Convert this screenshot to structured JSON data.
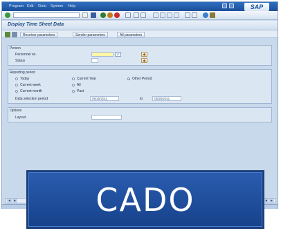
{
  "menubar": {
    "items": [
      "Program",
      "Edit",
      "Goto",
      "System",
      "Help"
    ],
    "logo": "SAP"
  },
  "toolbar": {
    "command_value": ""
  },
  "title": "Display Time Sheet Data",
  "app_toolbar": {
    "buttons": [
      "Receiver parameters",
      "Sender parameters",
      "All parameters"
    ]
  },
  "person": {
    "title": "Person",
    "personnel_no_label": "Personnel no.",
    "personnel_no_value": "",
    "status_label": "Status",
    "status_value": ""
  },
  "reporting_period": {
    "title": "Reporting period",
    "options": [
      "Today",
      "Current week",
      "Current month",
      "Current Year",
      "All",
      "Past",
      "Other Period"
    ],
    "selected": "Other Period",
    "data_selection_label": "Data selection period",
    "from": "05/25/2011",
    "to_label": "to",
    "to": "05/25/2011"
  },
  "options_group": {
    "title": "Options",
    "layout_label": "Layout",
    "layout_value": ""
  },
  "banner": {
    "text": "CADO"
  }
}
